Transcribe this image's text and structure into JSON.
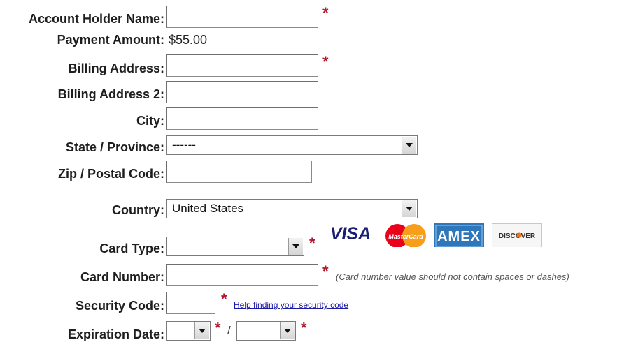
{
  "form": {
    "account_holder": {
      "label": "Account Holder Name:",
      "value": ""
    },
    "payment_amount": {
      "label": "Payment Amount:",
      "value": "$55.00"
    },
    "billing_address": {
      "label": "Billing Address:",
      "value": ""
    },
    "billing_address2": {
      "label": "Billing Address 2:",
      "value": ""
    },
    "city": {
      "label": "City:",
      "value": ""
    },
    "state": {
      "label": "State / Province:",
      "selected": "------"
    },
    "zip": {
      "label": "Zip / Postal Code:",
      "value": ""
    },
    "country": {
      "label": "Country:",
      "selected": "United States"
    },
    "card_type": {
      "label": "Card Type:",
      "selected": ""
    },
    "card_number": {
      "label": "Card Number:",
      "value": "",
      "note": "(Card number value should not contain spaces or dashes)"
    },
    "security_code": {
      "label": "Security Code:",
      "value": "",
      "help_link": "Help finding your security code"
    },
    "expiration": {
      "label": "Expiration Date:",
      "month": "",
      "separator": "/",
      "year": ""
    },
    "required_marker": "*"
  },
  "card_logos": [
    {
      "name": "visa",
      "text": "VISA"
    },
    {
      "name": "mastercard",
      "text": "MasterCard"
    },
    {
      "name": "amex",
      "text": "AMEX"
    },
    {
      "name": "discover",
      "text": "DISCOVER"
    }
  ],
  "colors": {
    "required": "#b0182b",
    "link": "#1a1aa6",
    "visa": "#1a1f71",
    "mastercard_red": "#eb001b",
    "mastercard_orange": "#f79e1b",
    "amex": "#2e77bb",
    "discover_orange": "#f47216"
  }
}
